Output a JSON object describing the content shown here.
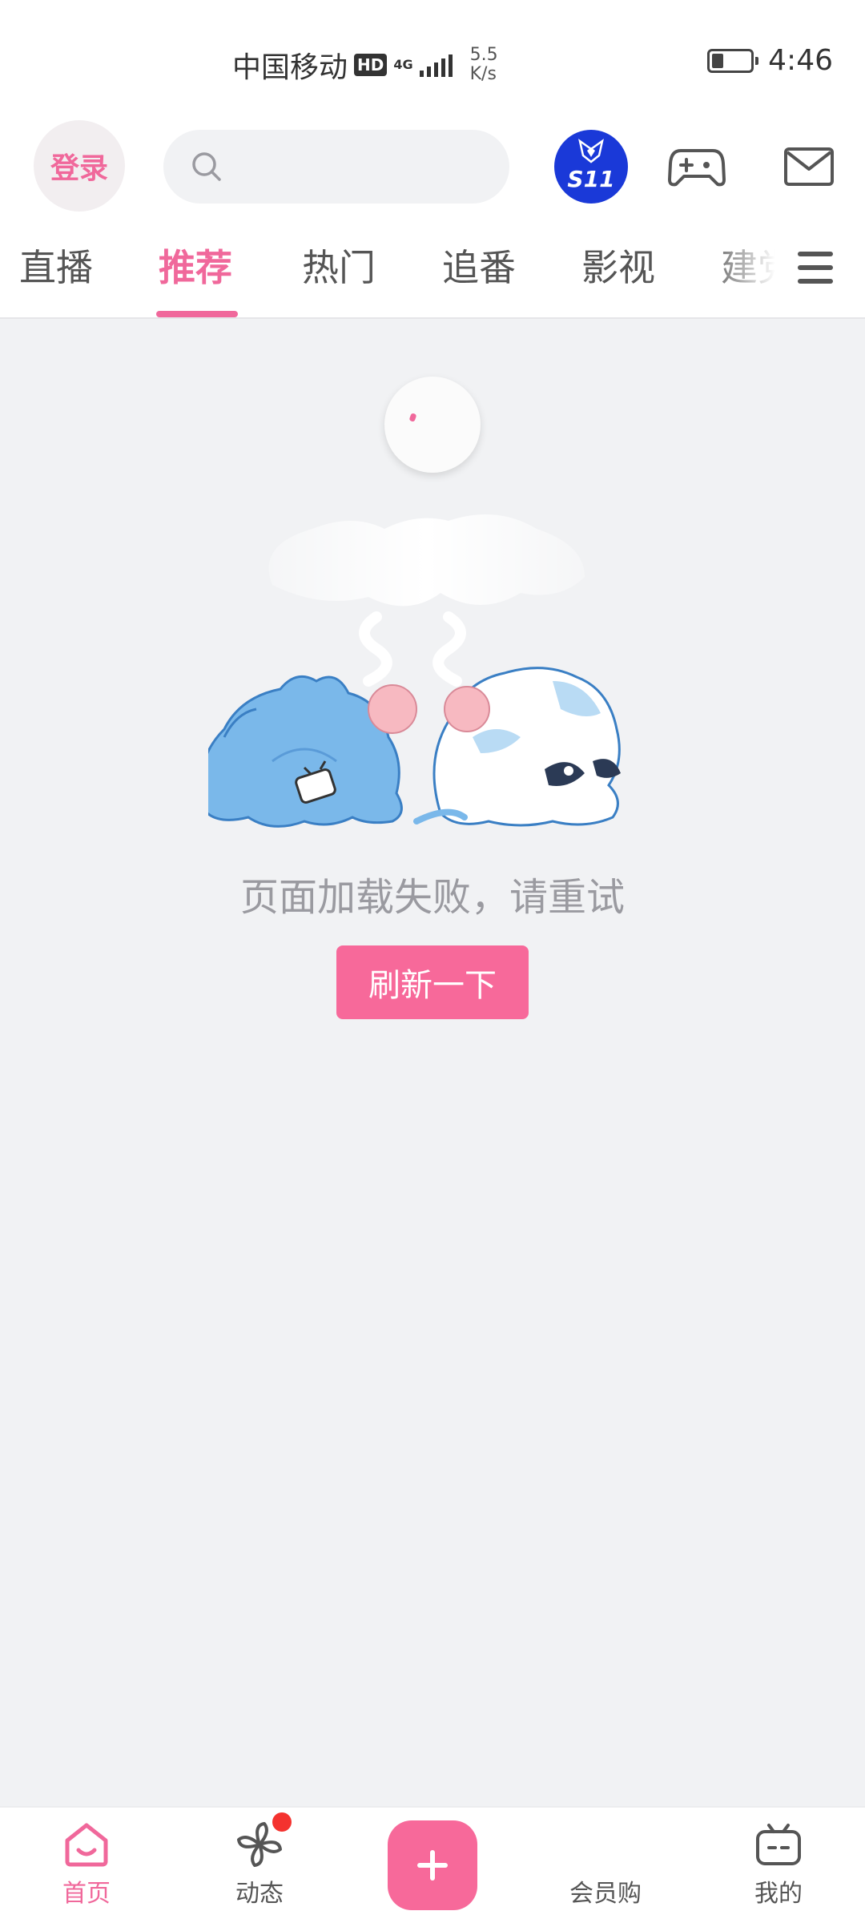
{
  "status_bar": {
    "carrier": "中国移动",
    "hd": "HD",
    "network": "4G",
    "speed_value": "5.5",
    "speed_unit": "K/s",
    "time": "4:46"
  },
  "header": {
    "login_label": "登录",
    "badge_label": "S11",
    "icons": [
      "search-icon",
      "s11-badge",
      "gamepad-icon",
      "mail-icon"
    ]
  },
  "tabs": [
    {
      "label": "直播",
      "active": false
    },
    {
      "label": "推荐",
      "active": true
    },
    {
      "label": "热门",
      "active": false
    },
    {
      "label": "追番",
      "active": false
    },
    {
      "label": "影视",
      "active": false
    },
    {
      "label": "建党",
      "active": false
    }
  ],
  "content": {
    "error_message": "页面加载失败，请重试",
    "refresh_label": "刷新一下"
  },
  "bottom_nav": [
    {
      "label": "首页",
      "icon": "home-icon",
      "active": true
    },
    {
      "label": "动态",
      "icon": "pinwheel-icon",
      "active": false,
      "badge_dot": true
    },
    {
      "label": "",
      "icon": "plus-icon",
      "active": false
    },
    {
      "label": "会员购",
      "icon": "",
      "active": false
    },
    {
      "label": "我的",
      "icon": "tv-icon",
      "active": false
    }
  ],
  "colors": {
    "accent": "#f0689b",
    "button": "#f7699a",
    "background": "#f1f2f4",
    "badge_blue": "#1a39d8",
    "notify_red": "#f4322f"
  }
}
